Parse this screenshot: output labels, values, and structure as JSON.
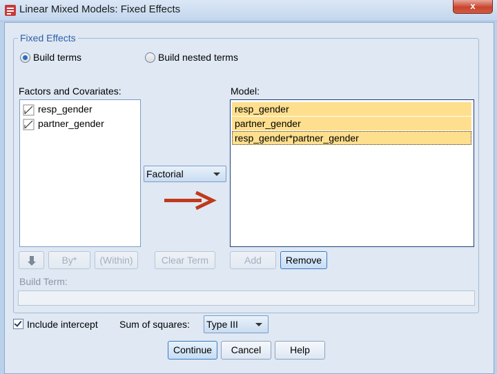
{
  "window": {
    "title": "Linear Mixed Models: Fixed Effects",
    "close_label": "x"
  },
  "fixed_effects": {
    "group_label": "Fixed Effects",
    "radio_build_terms": {
      "label": "Build terms",
      "checked": true
    },
    "radio_build_nested": {
      "label": "Build nested terms",
      "checked": false
    }
  },
  "factors": {
    "label": "Factors and Covariates:",
    "items": [
      {
        "label": "resp_gender",
        "icon": "scale-variable-icon"
      },
      {
        "label": "partner_gender",
        "icon": "scale-variable-icon"
      }
    ]
  },
  "model": {
    "label": "Model:",
    "items": [
      "resp_gender",
      "partner_gender",
      "resp_gender*partner_gender"
    ],
    "highlight_color": "#fddf8e"
  },
  "term_type": {
    "selected": "Factorial"
  },
  "arrow": {
    "color": "#c0391b",
    "icon": "right-arrow-icon"
  },
  "buttons": {
    "down_arrow": "down-arrow-icon",
    "by": "By*",
    "within": "(Within)",
    "clear_term": "Clear Term",
    "add": "Add",
    "remove": "Remove"
  },
  "build_term": {
    "label": "Build Term:",
    "value": ""
  },
  "intercept": {
    "label": "Include intercept",
    "checked": true
  },
  "sum_of_squares": {
    "label": "Sum of squares:",
    "selected": "Type III"
  },
  "footer": {
    "continue": "Continue",
    "cancel": "Cancel",
    "help": "Help"
  }
}
